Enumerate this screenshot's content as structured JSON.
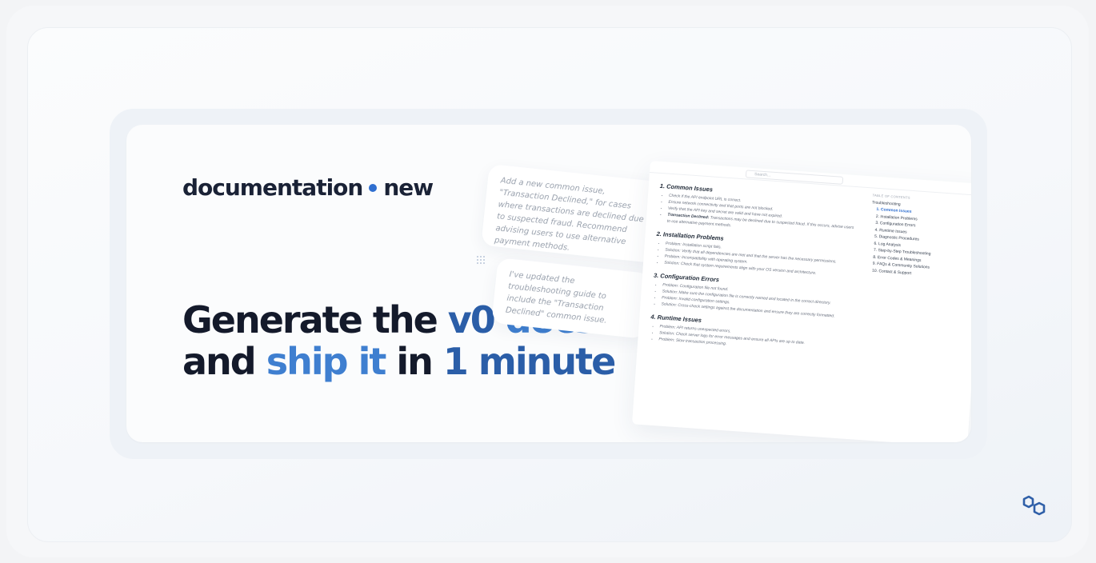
{
  "brand": {
    "name": "documentation",
    "suffix": "new"
  },
  "headline": {
    "line1_a": "Generate the ",
    "line1_b": "v0",
    "line1_c": " docs",
    "line2_a": "and ",
    "line2_b": "ship it",
    "line2_c": " in ",
    "line2_d": "1 minute"
  },
  "chat": {
    "user_message": "Add a new common issue, \"Transaction Declined,\" for cases where transactions are declined due to suspected fraud. Recommend advising users to use alternative payment methods.",
    "assistant_message": "I've updated the troubleshooting guide to include the \"Transaction Declined\" common issue."
  },
  "doc": {
    "search_placeholder": "Search...",
    "sections": [
      {
        "title": "1. Common Issues",
        "items": [
          "Check if the API endpoint URL is correct.",
          "Ensure network connectivity and that ports are not blocked.",
          "Verify that the API key and secret are valid and have not expired."
        ],
        "highlight_label": "Transaction Declined:",
        "highlight_text": "Transactions may be declined due to suspected fraud. If this occurs, advise users to use alternative payment methods."
      },
      {
        "title": "2. Installation Problems",
        "items": [
          "Problem: Installation script fails.",
          "Solution: Verify that all dependencies are met and that the server has the necessary permissions.",
          "Problem: Incompatibility with operating system.",
          "Solution: Check that system requirements align with your OS version and architecture."
        ]
      },
      {
        "title": "3. Configuration Errors",
        "items": [
          "Problem: Configuration file not found.",
          "Solution: Make sure the configuration file is correctly named and located in the correct directory.",
          "Problem: Invalid configuration settings.",
          "Solution: Cross-check settings against the documentation and ensure they are correctly formatted."
        ]
      },
      {
        "title": "4. Runtime Issues",
        "items": [
          "Problem: API returns unexpected errors.",
          "Solution: Check server logs for error messages and ensure all APIs are up to date.",
          "Problem: Slow transaction processing."
        ]
      }
    ],
    "toc": {
      "heading": "TABLE OF CONTENTS",
      "root": "Troubleshooting",
      "items": [
        "1. Common Issues",
        "2. Installation Problems",
        "3. Configuration Errors",
        "4. Runtime Issues",
        "5. Diagnostic Procedures",
        "6. Log Analysis",
        "7. Step-by-Step Troubleshooting",
        "8. Error Codes & Meanings",
        "9. FAQs & Community Solutions",
        "10. Contact & Support"
      ],
      "active_index": 0
    }
  },
  "colors": {
    "accent": "#2f6fd0",
    "heading": "#141a2b",
    "highlight": "#2b5ea8"
  },
  "icons": {
    "user": "user-icon",
    "assistant": "sparkle-icon",
    "logo": "hexagon-logo-icon"
  }
}
